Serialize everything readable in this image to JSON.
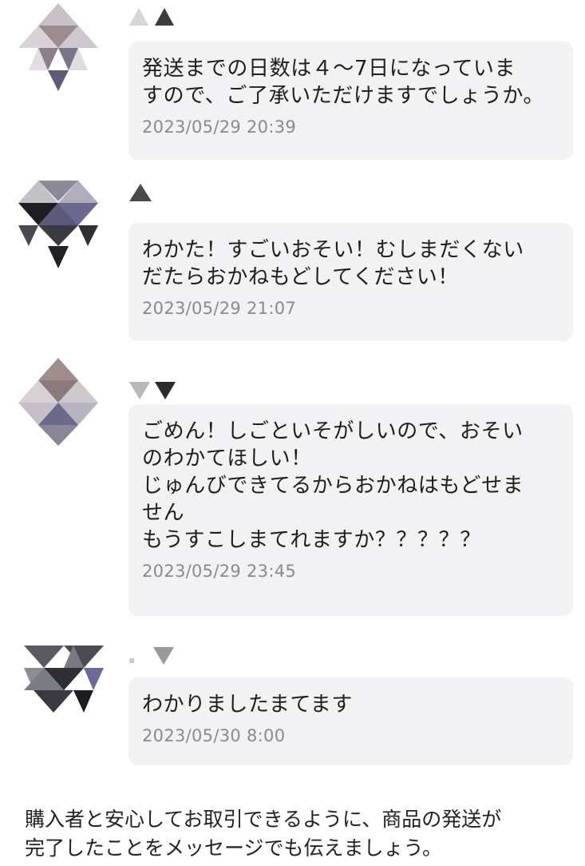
{
  "messages": [
    {
      "text": "発送までの日数は４〜7日になっていま\nすので、ご了承いただけますでしょうか。",
      "time": "2023/05/29 20:39"
    },
    {
      "text": "わかた！すごいおそい！むしまだくない\nだたらおかねもどしてください！",
      "time": "2023/05/29 21:07"
    },
    {
      "text": "ごめん！しごといそがしいので、おそい\nのわかてほしい！\nじゅんびできてるからおかねはもどせま\nせん\nもうすこしまてれますか？？？？？",
      "time": "2023/05/29 23:45"
    },
    {
      "text": "わかりましたまてます",
      "time": "2023/05/30 8:00"
    }
  ],
  "notice": "購入者と安心してお取引できるように、商品の発送が\n完了したことをメッセージでも伝えましょう。"
}
